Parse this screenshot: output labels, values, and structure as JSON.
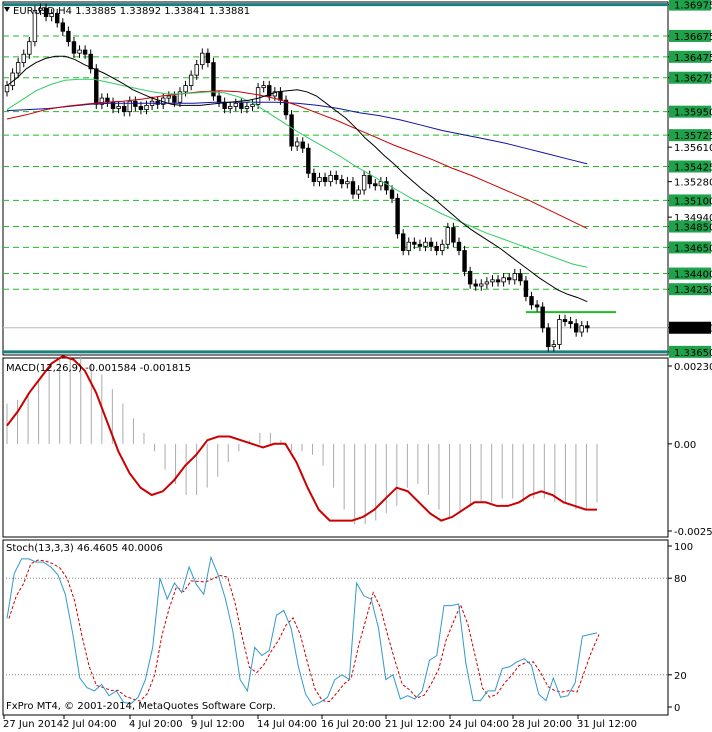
{
  "chart_data": [
    {
      "type": "candlestick",
      "panel": "price",
      "header": "EURUSD,H4  1.33885 1.33892 1.33841 1.33881",
      "symbol": "EURUSD",
      "timeframe": "H4",
      "ohlc_current": {
        "open": 1.33885,
        "high": 1.33892,
        "low": 1.33841,
        "close": 1.33881
      },
      "current_price_label": "1.33881",
      "ylim": [
        1.3362,
        1.37
      ],
      "y_ticks": [
        "1.36975",
        "1.36675",
        "1.36475",
        "1.36275",
        "1.35950",
        "1.35725",
        "1.35610",
        "1.35425",
        "1.35280",
        "1.35100",
        "1.34940",
        "1.34850",
        "1.34650",
        "1.34400",
        "1.34250",
        "1.33881",
        "1.33650"
      ],
      "horizontal_levels": [
        {
          "value": 1.36975,
          "color": "#1a7f7f",
          "style": "solid"
        },
        {
          "value": 1.3365,
          "color": "#1a7f7f",
          "style": "solid"
        },
        {
          "value": 1.3403,
          "color": "#22bb22",
          "style": "solid-short"
        },
        {
          "value": 1.36675,
          "color": "#22bb22",
          "style": "dashed"
        },
        {
          "value": 1.36475,
          "color": "#22bb22",
          "style": "dashed"
        },
        {
          "value": 1.36275,
          "color": "#22bb22",
          "style": "dashed"
        },
        {
          "value": 1.3595,
          "color": "#22bb22",
          "style": "dashed"
        },
        {
          "value": 1.35725,
          "color": "#22bb22",
          "style": "dashed"
        },
        {
          "value": 1.35425,
          "color": "#22bb22",
          "style": "dashed"
        },
        {
          "value": 1.351,
          "color": "#22bb22",
          "style": "dashed"
        },
        {
          "value": 1.3485,
          "color": "#22bb22",
          "style": "dashed"
        },
        {
          "value": 1.3465,
          "color": "#22bb22",
          "style": "dashed"
        },
        {
          "value": 1.344,
          "color": "#22bb22",
          "style": "dashed"
        },
        {
          "value": 1.3425,
          "color": "#22bb22",
          "style": "dashed"
        }
      ],
      "green_label_levels": [
        "1.36975",
        "1.36675",
        "1.36475",
        "1.36275",
        "1.35950",
        "1.35725",
        "1.35425",
        "1.35100",
        "1.34850",
        "1.34650",
        "1.34400",
        "1.34250",
        "1.33650"
      ],
      "ma_colors": {
        "black": "#000000",
        "green": "#33cc66",
        "red": "#cc0000",
        "blue": "#1111aa"
      },
      "candles_close": [
        1.362,
        1.3632,
        1.3642,
        1.365,
        1.3662,
        1.3692,
        1.3694,
        1.3686,
        1.3689,
        1.368,
        1.3672,
        1.3662,
        1.3651,
        1.3654,
        1.365,
        1.3636,
        1.3602,
        1.3608,
        1.3604,
        1.3598,
        1.36,
        1.3595,
        1.3605,
        1.36,
        1.3597,
        1.3601,
        1.3605,
        1.3602,
        1.3608,
        1.361,
        1.3604,
        1.3614,
        1.362,
        1.363,
        1.364,
        1.3651,
        1.3642,
        1.361,
        1.3604,
        1.3598,
        1.36,
        1.3603,
        1.3598,
        1.36,
        1.3602,
        1.3618,
        1.362,
        1.361,
        1.3614,
        1.3606,
        1.3592,
        1.3562,
        1.3566,
        1.356,
        1.3536,
        1.3528,
        1.3532,
        1.3528,
        1.3534,
        1.353,
        1.3526,
        1.3528,
        1.3516,
        1.352,
        1.3534,
        1.3526,
        1.3524,
        1.3528,
        1.352,
        1.3512,
        1.3478,
        1.3462,
        1.347,
        1.3468,
        1.3466,
        1.347,
        1.3466,
        1.3462,
        1.3468,
        1.3484,
        1.347,
        1.3462,
        1.3442,
        1.343,
        1.3428,
        1.343,
        1.3432,
        1.3434,
        1.3432,
        1.3436,
        1.3434,
        1.344,
        1.3433,
        1.3418,
        1.341,
        1.3408,
        1.3388,
        1.337,
        1.3372,
        1.3396,
        1.3394,
        1.3392,
        1.3384,
        1.339,
        1.3388
      ],
      "ma_black": [
        1.362,
        1.3627,
        1.3636,
        1.3642,
        1.3646,
        1.3648,
        1.3648,
        1.3645,
        1.364,
        1.3636,
        1.3632,
        1.3627,
        1.3622,
        1.3616,
        1.3612,
        1.3608,
        1.3605,
        1.3602,
        1.3601,
        1.3601,
        1.3601,
        1.3602,
        1.3603,
        1.3604,
        1.3605,
        1.3606,
        1.3608,
        1.3611,
        1.3614,
        1.3615,
        1.3616,
        1.3614,
        1.361,
        1.3603,
        1.3596,
        1.3589,
        1.358,
        1.357,
        1.3562,
        1.3553,
        1.3545,
        1.3536,
        1.3528,
        1.352,
        1.3513,
        1.3505,
        1.3497,
        1.3489,
        1.3482,
        1.3476,
        1.347,
        1.3464,
        1.3457,
        1.345,
        1.3443,
        1.3436,
        1.343,
        1.3424,
        1.342,
        1.3417,
        1.3413
      ],
      "ma_black_x": [
        0,
        4,
        8,
        12,
        16,
        20,
        24,
        28,
        32,
        36,
        40,
        44,
        48,
        52,
        56,
        60,
        64,
        68,
        72,
        76,
        80,
        84,
        88,
        92,
        96,
        100,
        104,
        108,
        112,
        116,
        120,
        124,
        128,
        132,
        136,
        140,
        144,
        148,
        152,
        156,
        160,
        164,
        168,
        172,
        176,
        180,
        184,
        188,
        192,
        196,
        200,
        204,
        208,
        212,
        216,
        220,
        224,
        228,
        232,
        236,
        240
      ],
      "ma_green": [
        1.3597,
        1.3606,
        1.3615,
        1.3621,
        1.3625,
        1.3626,
        1.3626,
        1.3623,
        1.362,
        1.3617,
        1.3614,
        1.3612,
        1.3612,
        1.3613,
        1.3614,
        1.3613,
        1.3609,
        1.3603,
        1.3594,
        1.3585,
        1.3576,
        1.3568,
        1.356,
        1.3552,
        1.3543,
        1.3535,
        1.3527,
        1.3519,
        1.3511,
        1.3504,
        1.3497,
        1.3491,
        1.3485,
        1.3479,
        1.3474,
        1.3469,
        1.3464,
        1.3459,
        1.3454,
        1.3449,
        1.3446
      ],
      "ma_red": [
        1.3588,
        1.3592,
        1.3597,
        1.36,
        1.3602,
        1.3604,
        1.3605,
        1.3607,
        1.361,
        1.3612,
        1.3614,
        1.3615,
        1.3614,
        1.3611,
        1.3607,
        1.3601,
        1.3594,
        1.3587,
        1.3579,
        1.3571,
        1.3563,
        1.3556,
        1.3549,
        1.3541,
        1.3534,
        1.3526,
        1.3518,
        1.351,
        1.3501,
        1.3492,
        1.3483
      ],
      "ma_blue": [
        1.3596,
        1.3597,
        1.3598,
        1.36,
        1.3602,
        1.3603,
        1.3603,
        1.3603,
        1.3603,
        1.3603,
        1.3604,
        1.3604,
        1.3604,
        1.3604,
        1.3603,
        1.3601,
        1.3598,
        1.3594,
        1.3591,
        1.3587,
        1.3582,
        1.3577,
        1.3573,
        1.3569,
        1.3565,
        1.356,
        1.3555,
        1.355,
        1.3545
      ]
    },
    {
      "type": "histogram+line",
      "panel": "macd",
      "header": "MACD(12,26,9) -0.001584 -0.001815",
      "indicator": "MACD(12,26,9)",
      "main_value": "-0.001584",
      "signal_value": "-0.001815",
      "ylim": [
        -0.00255,
        0.00235
      ],
      "y_ticks": [
        "0.002309",
        "0.00",
        "-0.002521"
      ],
      "histogram": [
        0.0011,
        0.0012,
        0.0014,
        0.0017,
        0.002,
        0.0023,
        0.0024,
        0.0024,
        0.0022,
        0.0019,
        0.0015,
        0.0011,
        0.0007,
        0.0003,
        -0.0002,
        -0.0007,
        -0.0011,
        -0.0014,
        -0.0014,
        -0.0012,
        -0.0009,
        -0.0005,
        -0.0002,
        0.0001,
        0.0003,
        0.0003,
        0.0001,
        -0.0002,
        -0.0002,
        -0.0003,
        -0.0006,
        -0.0012,
        -0.0018,
        -0.0022,
        -0.0022,
        -0.0021,
        -0.0019,
        -0.0017,
        -0.0012,
        -0.0011,
        -0.0014,
        -0.0018,
        -0.002,
        -0.0019,
        -0.0017,
        -0.0016,
        -0.0016,
        -0.0015,
        -0.0015,
        -0.0016,
        -0.0015,
        -0.0015,
        -0.0016,
        -0.0016,
        -0.0018,
        -0.0018,
        -0.0016
      ],
      "signal": [
        0.0005,
        0.0009,
        0.0014,
        0.0018,
        0.0022,
        0.0024,
        0.0023,
        0.002,
        0.0014,
        0.0006,
        -0.0002,
        -0.0008,
        -0.0012,
        -0.0014,
        -0.0013,
        -0.001,
        -0.0006,
        -0.0003,
        0.0001,
        0.0002,
        0.0002,
        0.0001,
        0.0,
        -0.0001,
        0.0,
        0.0,
        -0.0005,
        -0.0012,
        -0.0018,
        -0.0021,
        -0.0021,
        -0.0021,
        -0.002,
        -0.0018,
        -0.0015,
        -0.0012,
        -0.0013,
        -0.0016,
        -0.0019,
        -0.0021,
        -0.002,
        -0.0018,
        -0.0016,
        -0.0016,
        -0.0017,
        -0.0017,
        -0.0016,
        -0.0014,
        -0.0013,
        -0.0014,
        -0.0016,
        -0.0017,
        -0.0018,
        -0.0018
      ]
    },
    {
      "type": "line",
      "panel": "stochastic",
      "header": "Stoch(13,3,3) 46.4605 40.0006",
      "indicator": "Stoch(13,3,3)",
      "main_value": "46.4605",
      "signal_value": "40.0006",
      "ylim": [
        0,
        100
      ],
      "y_ticks": [
        "100",
        "80",
        "20",
        "0"
      ],
      "levels": [
        80,
        20
      ],
      "main": [
        55,
        83,
        92,
        92,
        90,
        90,
        87,
        82,
        70,
        46,
        18,
        12,
        10,
        14,
        7,
        10,
        3,
        2,
        6,
        17,
        37,
        80,
        67,
        77,
        71,
        87,
        76,
        70,
        93,
        82,
        67,
        47,
        17,
        10,
        37,
        32,
        35,
        57,
        60,
        49,
        25,
        8,
        1,
        3,
        6,
        17,
        20,
        17,
        77,
        69,
        67,
        49,
        17,
        20,
        5,
        7,
        5,
        10,
        29,
        32,
        63,
        63,
        64,
        27,
        4,
        4,
        10,
        10,
        24,
        25,
        28,
        30,
        26,
        8,
        4,
        18,
        6,
        7,
        15,
        44,
        45,
        46
      ]
    }
  ],
  "x_ticks": [
    "27 Jun 2014",
    "2 Jul 04:00",
    "4 Jul 20:00",
    "9 Jul 12:00",
    "14 Jul 04:00",
    "16 Jul 20:00",
    "21 Jul 12:00",
    "24 Jul 04:00",
    "28 Jul 20:00",
    "31 Jul 12:00"
  ],
  "footer": "FxPro MT4, © 2001-2014, MetaQuotes Software Corp.",
  "colors": {
    "macd_signal": "#cc0000",
    "macd_hist": "#aaaaaa",
    "stoch_main": "#3399cc",
    "stoch_signal": "#cc0000",
    "current_label_bg": "#000000",
    "level_label_bg": "#1fa34a"
  }
}
